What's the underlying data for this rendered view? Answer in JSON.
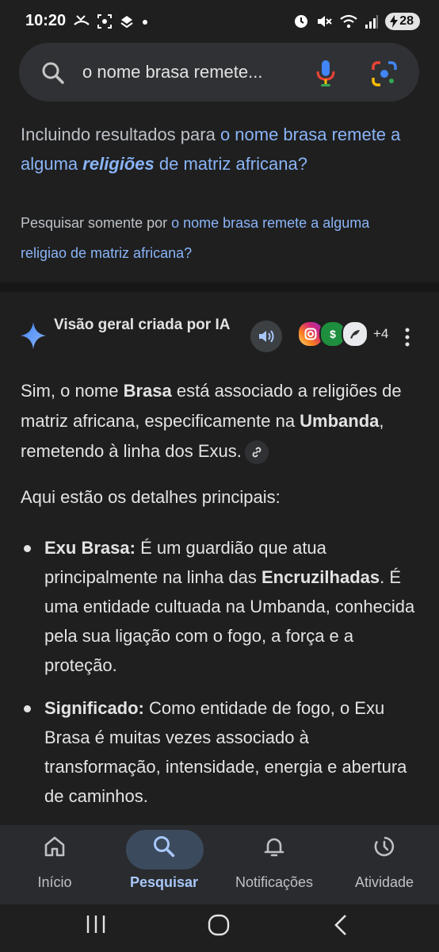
{
  "status_bar": {
    "time": "10:20",
    "battery": "28"
  },
  "search": {
    "query": "o nome brasa remete..."
  },
  "including": {
    "prefix": "Incluindo resultados para ",
    "link_part1": "o nome brasa remete a alguma ",
    "link_emph": "religiões",
    "link_part2": " de matriz africana?"
  },
  "only": {
    "prefix": "Pesquisar somente por ",
    "link": "o nome brasa remete a alguma religiao de matriz africana?"
  },
  "ai_overview": {
    "title": "Visão geral criada por IA",
    "sources_more": "+4",
    "p1": {
      "t1": "Sim, o nome ",
      "b1": "Brasa",
      "t2": " está associado a religiões de matriz africana, especificamente na ",
      "b2": "Umbanda",
      "t3": ", remetendo à linha dos Exus."
    },
    "p2": "Aqui estão os detalhes principais:",
    "items": [
      {
        "label": "Exu Brasa:",
        "t1": " É um guardião que atua principalmente na linha das ",
        "b1": "Encruzilhadas",
        "t2": ". É uma entidade cultuada na Umbanda, conhecida pela sua ligação com o fogo, a força e a proteção."
      },
      {
        "label": "Significado:",
        "t1": " Como entidade de fogo, o Exu Brasa é muitas vezes associado à transformação, intensidade, energia e abertura de caminhos."
      }
    ]
  },
  "bottom_nav": {
    "items": [
      {
        "label": "Início",
        "icon": "home-icon"
      },
      {
        "label": "Pesquisar",
        "icon": "search-icon"
      },
      {
        "label": "Notificações",
        "icon": "bell-icon"
      },
      {
        "label": "Atividade",
        "icon": "activity-icon"
      }
    ]
  },
  "colors": {
    "background": "#1f1f1f",
    "link": "#8ab4f8",
    "active_nav": "#a8c7fa"
  }
}
